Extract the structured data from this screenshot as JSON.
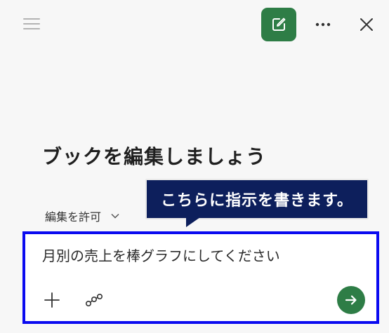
{
  "header": {
    "menu_icon": "hamburger-menu-icon",
    "new_chat_icon": "edit-compose-icon",
    "more_icon": "more-dots-icon",
    "close_icon": "close-icon",
    "accent_color": "#2e7d46"
  },
  "main": {
    "heading": "ブックを編集しましょう",
    "permission_dropdown": {
      "label": "編集を許可",
      "icon": "chevron-down-icon"
    }
  },
  "annotation": {
    "callout_text": "こちらに指示を書きます。",
    "callout_color": "#0d1f5c",
    "highlight_color": "#0a0af0"
  },
  "composer": {
    "value": "月別の売上を棒グラフにしてください",
    "add_icon": "plus-icon",
    "connect_icon": "link-nodes-icon",
    "send_icon": "arrow-right-icon"
  }
}
